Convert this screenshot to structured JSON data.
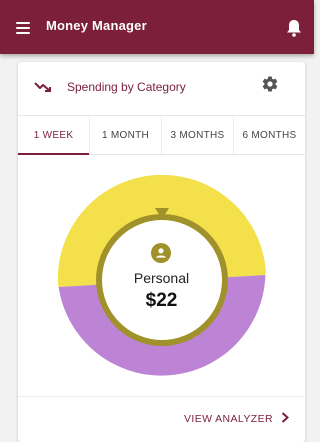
{
  "appbar": {
    "title": "Money Manager",
    "menu_icon": "hamburger-menu-icon",
    "bell_icon": "bell-icon",
    "background": "#7b1f3a"
  },
  "card": {
    "title": "Spending by Category",
    "trend_icon": "trending-down-icon",
    "settings_icon": "gear-icon"
  },
  "tabs": [
    {
      "label": "1 WEEK",
      "active": true
    },
    {
      "label": "1 MONTH",
      "active": false
    },
    {
      "label": "3 MONTHS",
      "active": false
    },
    {
      "label": "6 MONTHS",
      "active": false
    }
  ],
  "chart": {
    "selected_category": "Personal",
    "selected_amount": "$22",
    "selected_icon": "person-circle-icon",
    "segments": [
      {
        "color": "#f3e04b",
        "share": 0.55
      },
      {
        "color": "#bd84d5",
        "share": 0.45
      }
    ],
    "ring_color": "#a0912a"
  },
  "footer": {
    "view_analyzer_label": "VIEW ANALYZER",
    "chevron_icon": "chevron-right-icon"
  }
}
